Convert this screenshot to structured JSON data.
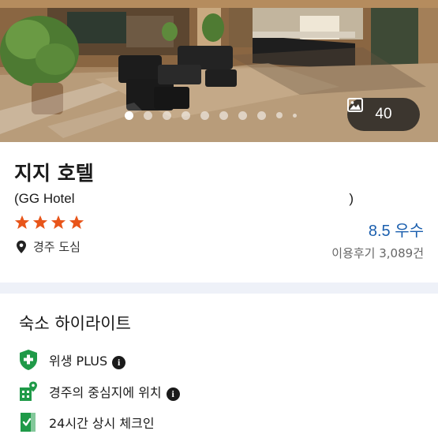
{
  "hero": {
    "photo_count": "40",
    "carousel_dots": 10,
    "active_dot": 0
  },
  "hotel": {
    "name": "지지 호텔",
    "english_name_open": "(GG Hotel",
    "english_name_close": ")",
    "star_rating": 4,
    "star_color": "#e8551a",
    "location": "경주 도심",
    "score": "8.5 우수",
    "review_count": "이용후기 3,089건"
  },
  "highlights": {
    "title": "숙소 하이라이트",
    "items": [
      {
        "icon": "shield-plus-icon",
        "label": "위생 PLUS",
        "has_info": true
      },
      {
        "icon": "map-pin-icon",
        "label": "경주의 중심지에 위치",
        "has_info": true
      },
      {
        "icon": "door-check-icon",
        "label": "24시간 상시 체크인",
        "has_info": false
      }
    ]
  },
  "colors": {
    "accent_green": "#1f9a48",
    "score_blue": "#1b5fae",
    "band": "#eef1f8"
  }
}
